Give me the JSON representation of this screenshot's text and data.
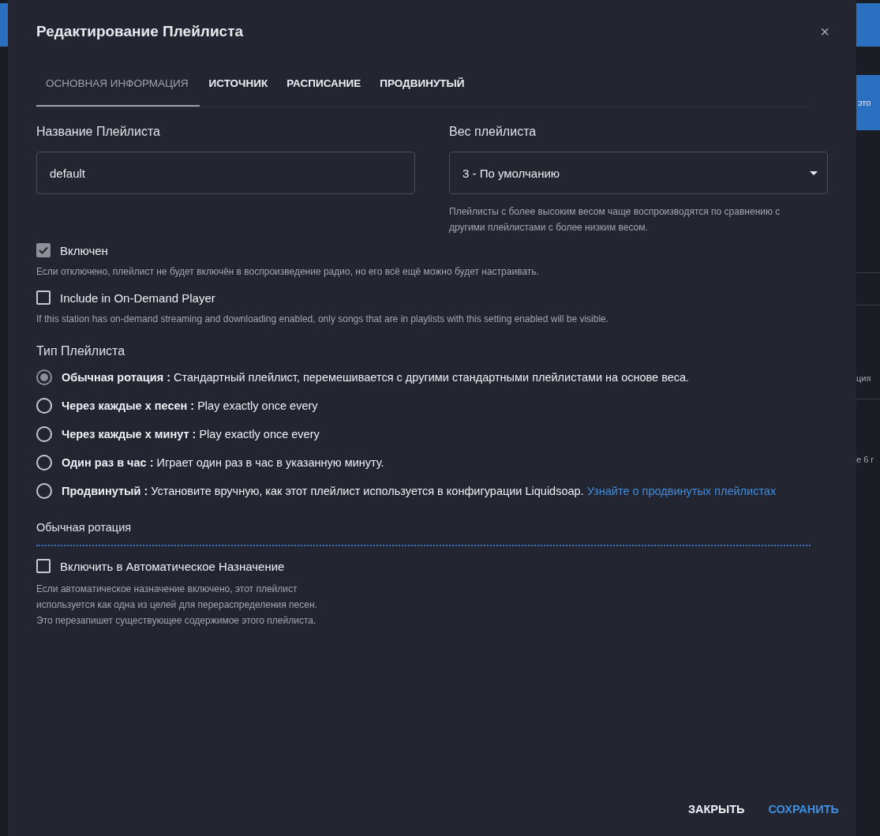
{
  "dialog": {
    "title": "Редактирование Плейлиста",
    "close": "×"
  },
  "tabs": [
    {
      "label": "ОСНОВНАЯ ИНФОРМАЦИЯ",
      "selected": true
    },
    {
      "label": "ИСТОЧНИК",
      "selected": false
    },
    {
      "label": "РАСПИСАНИЕ",
      "selected": false
    },
    {
      "label": "ПРОДВИНУТЫЙ",
      "selected": false
    }
  ],
  "name_field": {
    "label": "Название Плейлиста",
    "value": "default"
  },
  "weight_field": {
    "label": "Вес плейлиста",
    "value": "3 - По умолчанию",
    "help": "Плейлисты с более высоким весом чаще воспроизводятся по сравнению с другими плейлистами с более низким весом."
  },
  "options": [
    {
      "label": "Включен",
      "checked": true,
      "help": "Если отключено, плейлист не будет включён в воспроизведение радио, но его всё ещё можно будет настраивать."
    },
    {
      "label": "Include in On-Demand Player",
      "checked": false,
      "help": "If this station has on-demand streaming and downloading enabled, only songs that are in playlists with this setting enabled will be visible."
    }
  ],
  "playlist_type": {
    "label": "Тип Плейлиста",
    "choices": [
      {
        "text": "**Обычная ротация :** Стандартный плейлист, перемешивается с другими стандартными плейлистами на основе веса.",
        "selected": true
      },
      {
        "text": "**Через каждые х песен :** Play exactly once every",
        "selected": false
      },
      {
        "text": "**Через каждые х минут :** Play exactly once every",
        "selected": false
      },
      {
        "text": "**Один раз в час :** Играет один раз в час в указанную минуту.",
        "selected": false
      },
      {
        "text": "**Продвинутый :** Установите вручную, как этот плейлист используется в конфигурации Liquidsoap.",
        "link": "Узнайте о продвинутых плейлистах",
        "selected": false
      }
    ]
  },
  "rotation": {
    "heading": "Обычная ротация",
    "option": {
      "label": "Включить в Автоматическое Назначение",
      "checked": false
    },
    "help": [
      "Если автоматическое назначение включено, этот плейлист",
      "используется как одна из целей для перераспределения песен.",
      "Это перезапишет существующее содержимое этого плейлиста."
    ]
  },
  "footer": [
    "ЗАКРЫТЬ",
    "СОХРАНИТЬ"
  ],
  "backdrop": [
    "это",
    "ция",
    "е 6 г"
  ]
}
